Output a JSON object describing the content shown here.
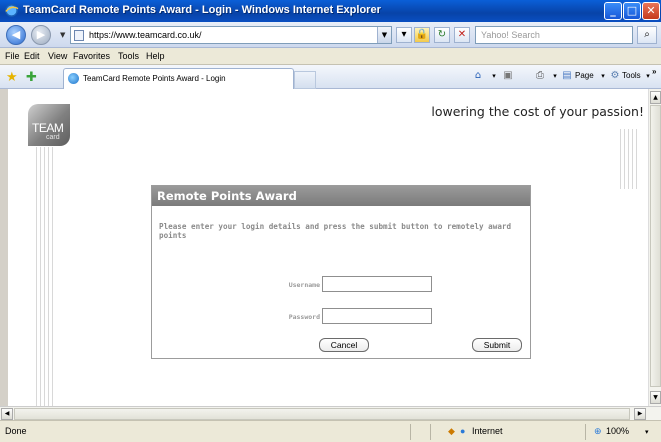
{
  "window": {
    "title": "TeamCard Remote Points Award - Login - Windows Internet Explorer",
    "minimize": "_",
    "maximize": "□",
    "close": "✕"
  },
  "address": {
    "url": "https://www.teamcard.co.uk/",
    "search_placeholder": "Yahoo! Search"
  },
  "menu": [
    "File",
    "Edit",
    "View",
    "Favorites",
    "Tools",
    "Help"
  ],
  "tab": {
    "label": "TeamCard Remote Points Award - Login"
  },
  "commands": {
    "page": "Page",
    "tools": "Tools",
    "more": "»"
  },
  "page": {
    "logo_team": "TEAM",
    "logo_card": "card",
    "tagline": "lowering the cost of your passion!",
    "panel_title": "Remote Points Award",
    "instructions": "Please enter your login details and press the submit button to remotely award points",
    "username_label": "Username",
    "password_label": "Password",
    "cancel_label": "Cancel",
    "submit_label": "Submit"
  },
  "status": {
    "text": "Done",
    "zone": "Internet",
    "zoom": "100%"
  }
}
